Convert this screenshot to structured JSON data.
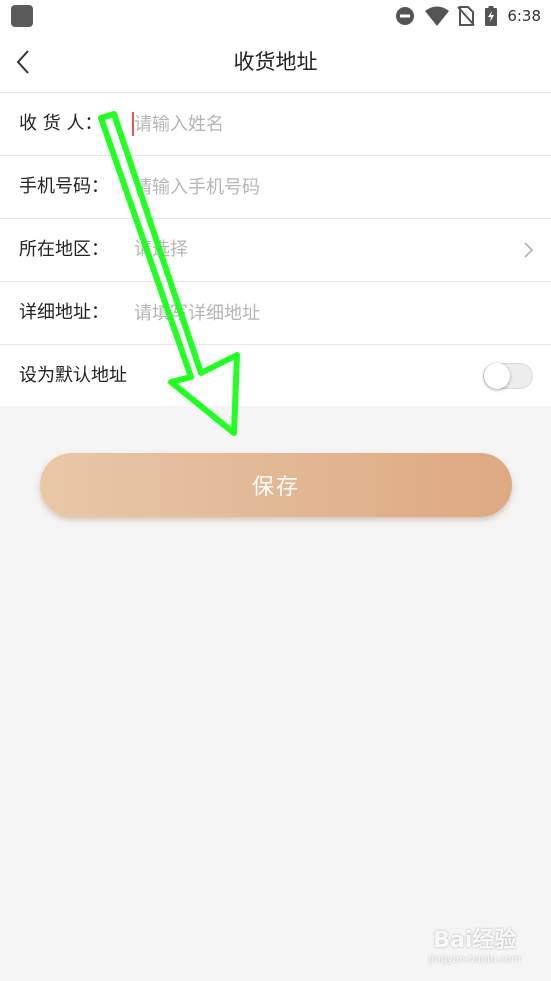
{
  "status_bar": {
    "time": "6:38",
    "icons": [
      "app-icon",
      "do-not-disturb-icon",
      "wifi-icon",
      "no-sim-icon",
      "battery-charging-icon"
    ]
  },
  "nav": {
    "title": "收货地址",
    "back_icon": "chevron-left-icon"
  },
  "form": {
    "receiver": {
      "label": "收 货 人：",
      "placeholder": "请输入姓名",
      "value": ""
    },
    "phone": {
      "label": "手机号码：",
      "placeholder": "请输入手机号码",
      "value": ""
    },
    "region": {
      "label": "所在地区：",
      "placeholder": "请选择",
      "chevron_icon": "chevron-right-icon"
    },
    "detail": {
      "label": "详细地址：",
      "placeholder": "请填写详细地址",
      "value": ""
    },
    "default_address": {
      "label": "设为默认地址",
      "enabled": false
    }
  },
  "actions": {
    "save_label": "保存"
  },
  "colors": {
    "button_gradient_start": "#e8c7a7",
    "button_gradient_end": "#dda982",
    "annotation_arrow": "#22ff22",
    "caret": "#e05a5a"
  },
  "watermark": {
    "brand": "Bai经验",
    "domain": "jingyan.baidu.com"
  }
}
